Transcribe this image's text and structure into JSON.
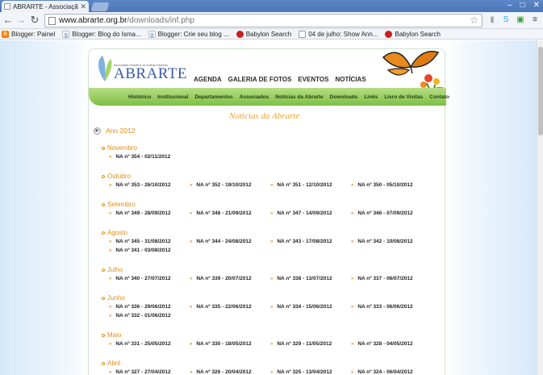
{
  "browser": {
    "tab_title": "ABRARTE - Associação Brasile",
    "url_host": "www.abrarte.org.br",
    "url_path": "/downloads/inf.php",
    "bookmarks": [
      {
        "label": "Blogger: Painel",
        "icon": "blogger-icon"
      },
      {
        "label": "Blogger: Blog do Isma...",
        "icon": "google-icon"
      },
      {
        "label": "Blogger: Crie seu blog ...",
        "icon": "google-icon"
      },
      {
        "label": "Babylon Search",
        "icon": "babylon-icon"
      },
      {
        "label": "04 de julho: Show Ann...",
        "icon": "page-icon"
      },
      {
        "label": "Babylon Search",
        "icon": "babylon-icon"
      }
    ]
  },
  "site": {
    "logo_subtitle": "Associação Brasileira de Artistas Espíritas",
    "logo_name": "ABRARTE",
    "topnav": [
      "AGENDA",
      "GALERIA DE FOTOS",
      "EVENTOS",
      "NOTÍCIAS"
    ],
    "subnav": [
      "Histórico",
      "Institucional",
      "Departamentos",
      "Associados",
      "Notícias da Abrarte",
      "Downloads",
      "Links",
      "Livro de Visitas",
      "Contato"
    ],
    "heading": "Notícias da Abrarte",
    "year": "Ano 2012"
  },
  "months": [
    {
      "name": "Novembro",
      "items": [
        "NA nº 354 - 02/11/2012"
      ]
    },
    {
      "name": "Outubro",
      "items": [
        "NA nº 353 - 26/10/2012",
        "NA nº 352 - 19/10/2012",
        "NA nº 351 - 12/10/2012",
        "NA nº 350 - 05/10/2012"
      ]
    },
    {
      "name": "Setembro",
      "items": [
        "NA nº 349 - 28/09/2012",
        "NA nº 348 - 21/09/2012",
        "NA nº 347 - 14/09/2012",
        "NA nº 346 - 07/09/2012"
      ]
    },
    {
      "name": "Agosto",
      "items": [
        "NA nº 345 - 31/08/2012",
        "NA nº 344 - 24/08/2012",
        "NA nº 343 - 17/08/2012",
        "NA nº 342 - 10/08/2012",
        "NA nº 341 - 03/08/2012"
      ]
    },
    {
      "name": "Julho",
      "items": [
        "NA nº 340 - 27/07/2012",
        "NA nº 339 - 20/07/2012",
        "NA nº 338 - 13/07/2012",
        "NA nº 337 - 06/07/2012"
      ]
    },
    {
      "name": "Junho",
      "items": [
        "NA nº 336 - 29/06/2012",
        "NA nº 335 - 22/06/2012",
        "NA nº 334 - 15/06/2012",
        "NA nº 333 - 06/06/2012",
        "NA nº 332 - 01/06/2012"
      ]
    },
    {
      "name": "Maio",
      "items": [
        "NA nº 331 - 25/05/2012",
        "NA nº 330 - 18/05/2012",
        "NA nº 329 - 11/05/2012",
        "NA nº 328 - 04/05/2012"
      ]
    },
    {
      "name": "Abril",
      "items": [
        "NA nº 327 - 27/04/2012",
        "NA nº 326 - 20/04/2012",
        "NA nº 325 - 13/04/2012",
        "NA nº 324 - 06/04/2012"
      ]
    }
  ]
}
